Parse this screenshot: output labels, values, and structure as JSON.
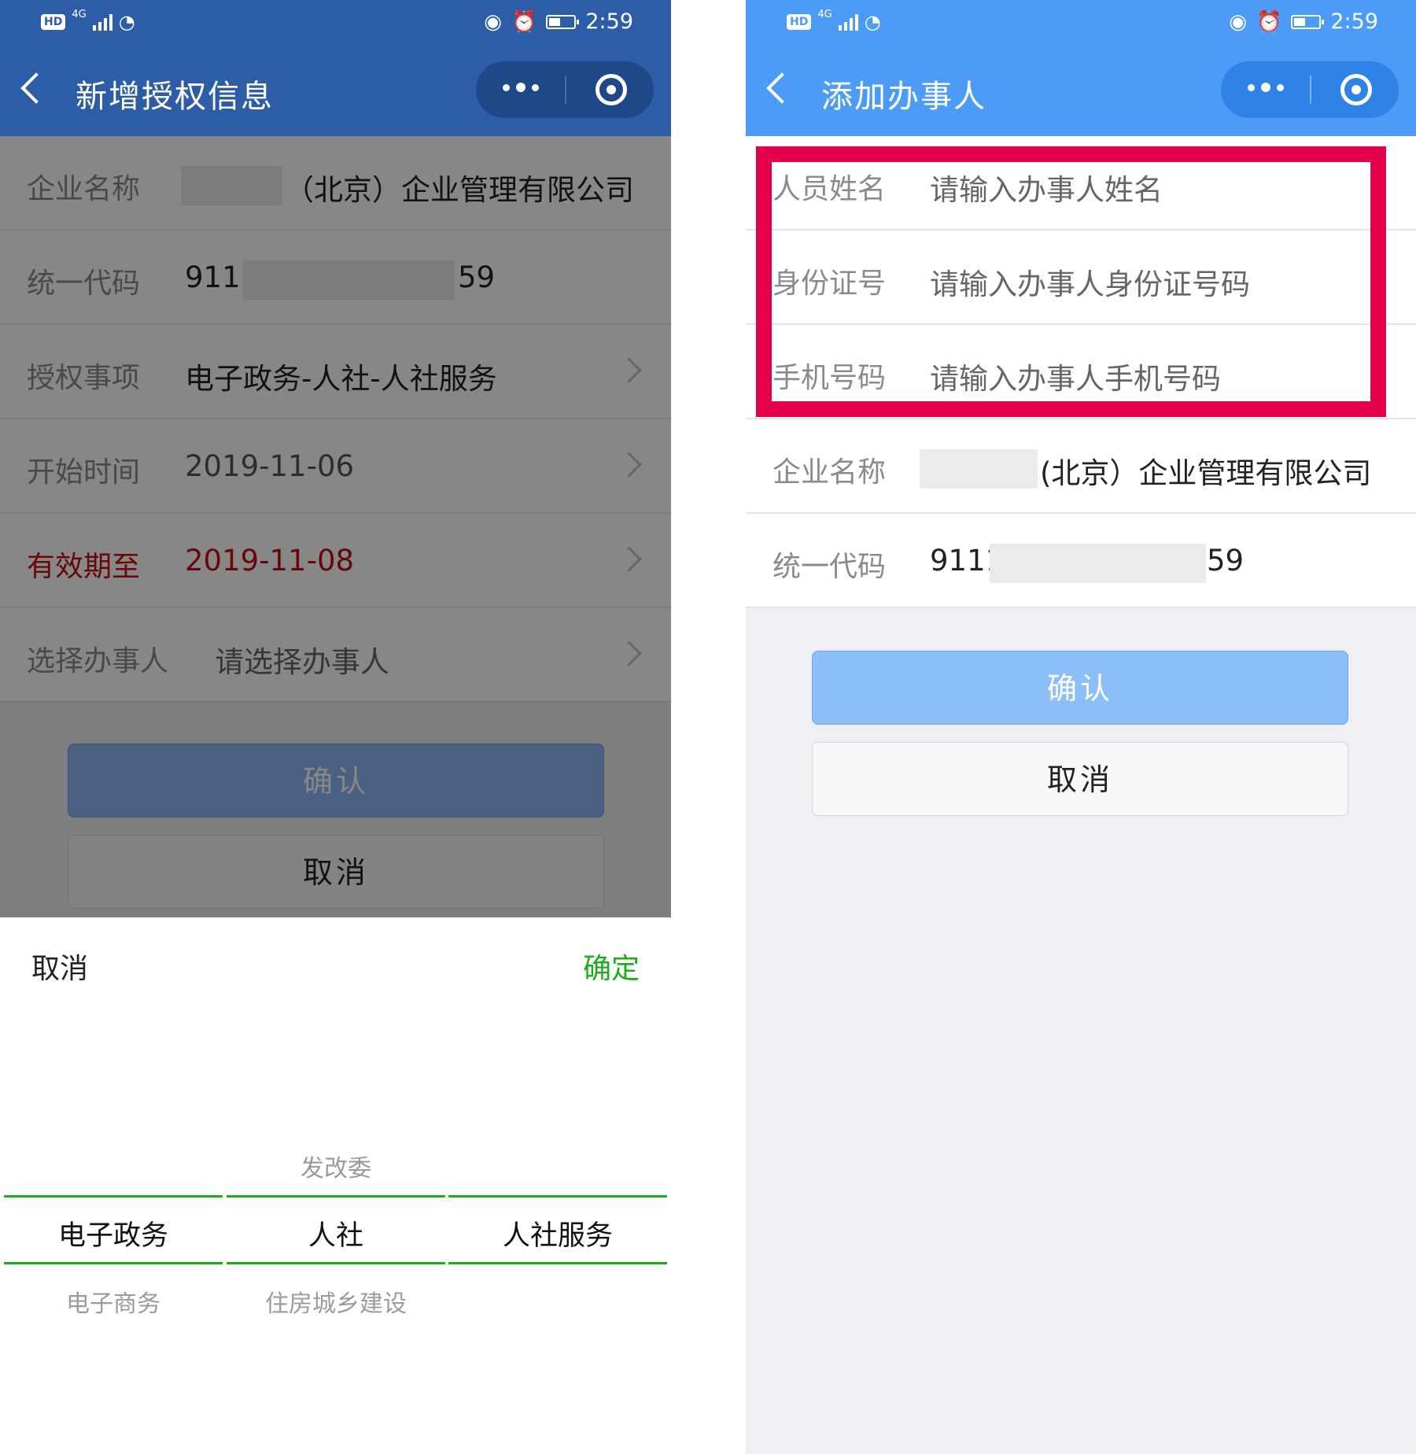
{
  "status": {
    "time": "2:59",
    "hd": "HD",
    "network": "4G"
  },
  "left": {
    "nav": {
      "title": "新增授权信息"
    },
    "rows": [
      {
        "label": "企业名称",
        "value": "（北京）企业管理有限公司"
      },
      {
        "label": "统一代码",
        "value_prefix": "9111",
        "value_suffix": "59"
      },
      {
        "label": "授权事项",
        "value": "电子政务-人社-人社服务"
      },
      {
        "label": "开始时间",
        "value": "2019-11-06"
      },
      {
        "label": "有效期至",
        "value": "2019-11-08"
      },
      {
        "label": "选择办事人",
        "value": "请选择办事人"
      }
    ],
    "confirm_label": "确认",
    "cancel_label": "取消",
    "picker": {
      "cancel": "取消",
      "ok": "确定",
      "columns": [
        {
          "above": "",
          "selected": "电子政务",
          "below": "电子商务"
        },
        {
          "above": "发改委",
          "selected": "人社",
          "below": "住房城乡建设"
        },
        {
          "above": "",
          "selected": "人社服务",
          "below": ""
        }
      ]
    }
  },
  "right": {
    "nav": {
      "title": "添加办事人"
    },
    "fields": [
      {
        "label": "人员姓名",
        "placeholder": "请输入办事人姓名"
      },
      {
        "label": "身份证号",
        "placeholder": "请输入办事人身份证号码"
      },
      {
        "label": "手机号码",
        "placeholder": "请输入办事人手机号码"
      }
    ],
    "rows": [
      {
        "label": "企业名称",
        "value": "(北京）企业管理有限公司"
      },
      {
        "label": "统一代码",
        "value_prefix": "9111",
        "value_suffix": "59"
      }
    ],
    "confirm_label": "确认",
    "cancel_label": "取消"
  },
  "colors": {
    "left_nav": "#2e5da8",
    "right_nav": "#4b9bf7",
    "highlight": "#e5004f",
    "picker_accent": "#1aad19",
    "expiry_red": "#c40f0f"
  }
}
